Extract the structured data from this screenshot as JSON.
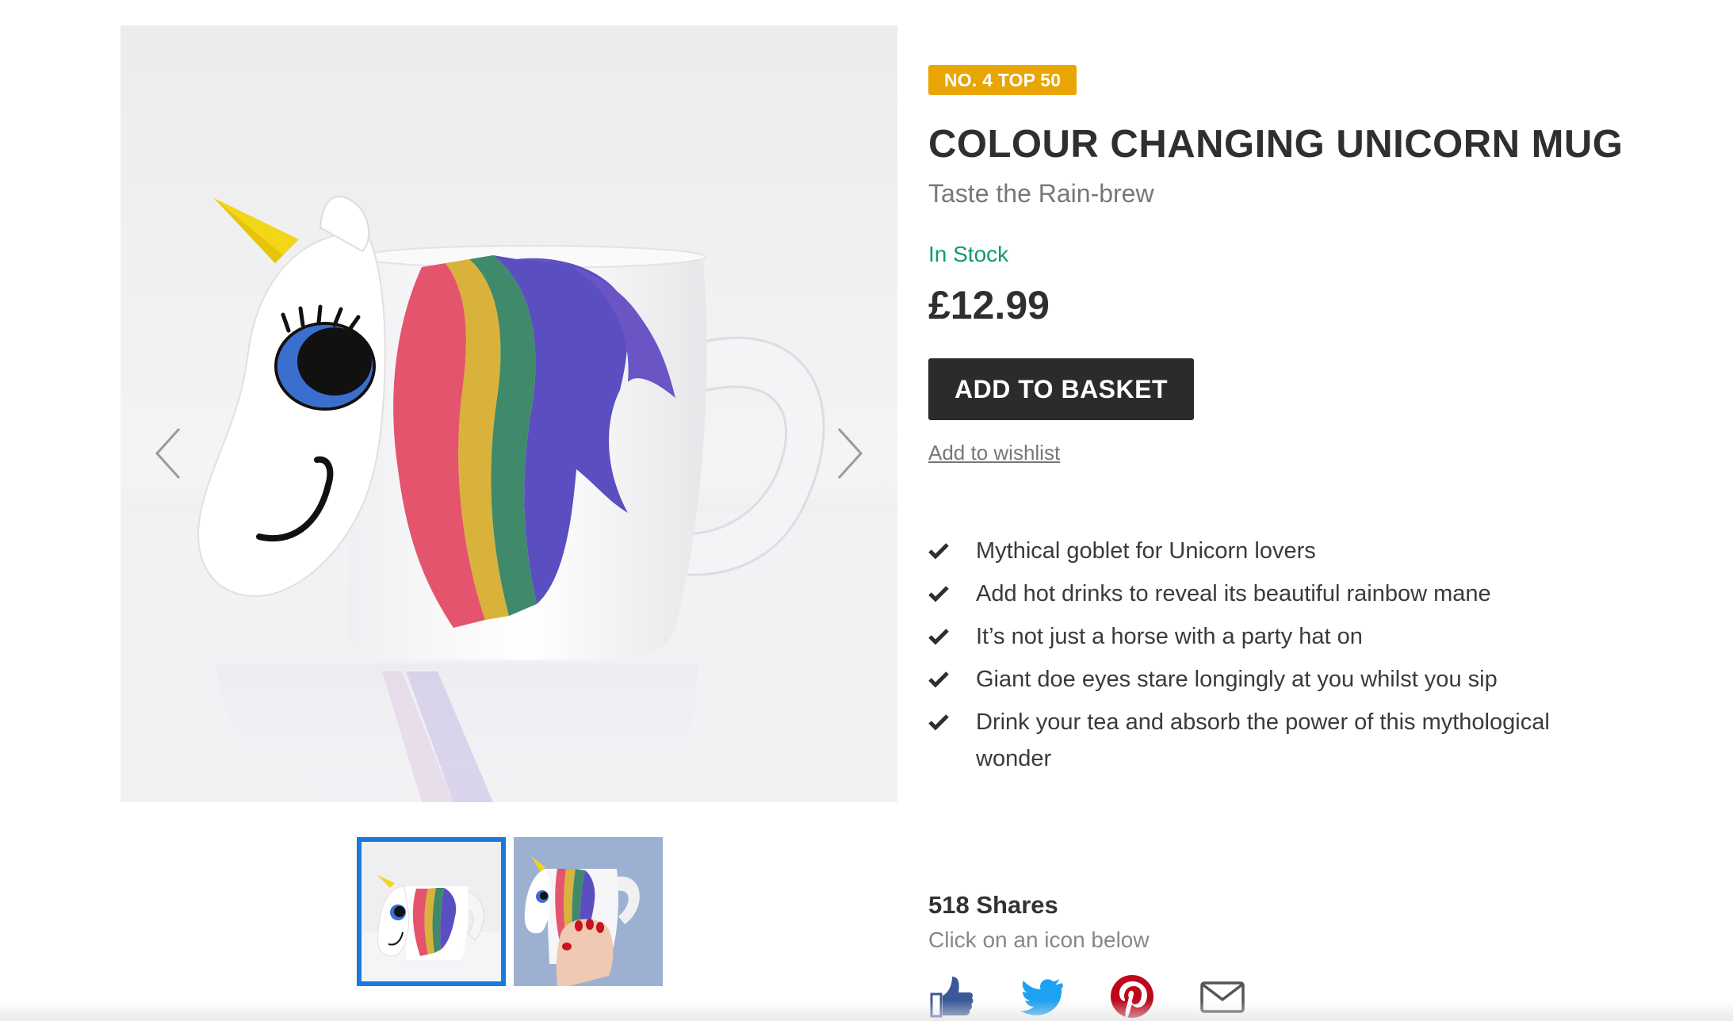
{
  "product": {
    "badge": "NO. 4 TOP 50",
    "title": "COLOUR CHANGING UNICORN MUG",
    "subtitle": "Taste the Rain-brew",
    "stock_status": "In Stock",
    "price": "£12.99",
    "add_to_basket_label": "ADD TO BASKET",
    "wishlist_label": "Add to wishlist",
    "features": [
      "Mythical goblet for Unicorn lovers",
      "Add hot drinks to reveal its beautiful rainbow mane",
      "It’s not just a horse with a party hat on",
      "Giant doe eyes stare longingly at you whilst you sip",
      "Drink your tea and absorb the power of this mythological wonder"
    ]
  },
  "gallery": {
    "prev_icon": "chevron-left-icon",
    "next_icon": "chevron-right-icon",
    "thumbnails_count": 2,
    "active_thumbnail": 1
  },
  "sharing": {
    "shares_label": "518 Shares",
    "hint": "Click on an icon below",
    "icons": [
      "facebook-like-icon",
      "twitter-icon",
      "pinterest-icon",
      "email-icon"
    ]
  },
  "colors": {
    "badge": "#e8a503",
    "stock": "#0f9b6e",
    "button": "#2b2b2b",
    "thumb_active": "#1a7ad9",
    "facebook": "#3b5998",
    "twitter": "#1da1f2",
    "pinterest": "#bd081c",
    "email": "#555555"
  }
}
